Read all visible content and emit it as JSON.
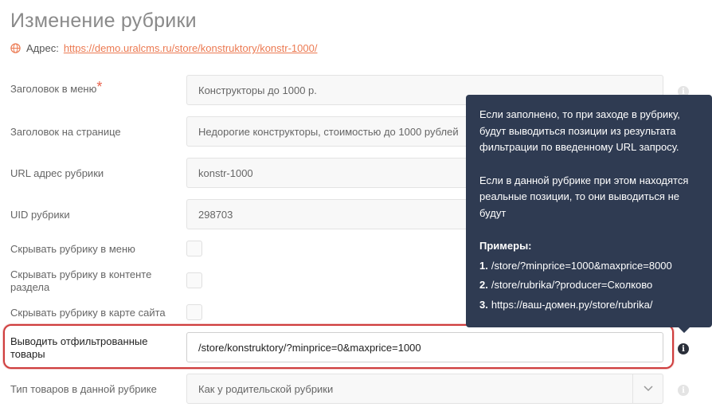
{
  "page_title": "Изменение рубрики",
  "address": {
    "label": "Адрес:",
    "url": "https://demo.uralcms.ru/store/konstruktory/konstr-1000/"
  },
  "fields": {
    "menu_title": {
      "label": "Заголовок в меню",
      "required_mark": "*",
      "value": "Конструкторы до 1000 р."
    },
    "page_title": {
      "label": "Заголовок на странице",
      "value": "Недорогие конструкторы, стоимостью до 1000 рублей"
    },
    "url": {
      "label": "URL адрес рубрики",
      "value": "konstr-1000"
    },
    "uid": {
      "label": "UID рубрики",
      "value": "298703"
    },
    "hide_menu": {
      "label": "Скрывать рубрику в меню",
      "checked": false
    },
    "hide_content": {
      "label": "Скрывать рубрику в контенте раздела",
      "checked": false
    },
    "hide_sitemap": {
      "label": "Скрывать рубрику в карте сайта",
      "checked": false
    },
    "filtered": {
      "label": "Выводить отфильтрованные товары",
      "value": "/store/konstruktory/?minprice=0&maxprice=1000"
    },
    "goods_type": {
      "label": "Тип товаров в данной рубрике",
      "value": "Как у родительской рубрики"
    }
  },
  "tooltip": {
    "para1": "Если заполнено, то при заходе в рубрику, будут выводиться позиции из результата фильтрации по введенному URL запросу.",
    "para2": "Если в данной рубрике при этом находятся реальные позиции, то они выводиться не будут",
    "examples_title": "Примеры:",
    "examples": [
      {
        "num": "1.",
        "text": "/store/?minprice=1000&maxprice=8000"
      },
      {
        "num": "2.",
        "text": "/store/rubrika/?producer=Сколково"
      },
      {
        "num": "3.",
        "text": "https://ваш-домен.ру/store/rubrika/"
      }
    ]
  },
  "icons": {
    "address": "globe-icon",
    "info": "info-icon",
    "select": "chevron-down-icon"
  },
  "colors": {
    "accent_link": "#ec7a52",
    "required": "#e8604a",
    "highlight": "#cf3d3d",
    "tooltip_bg": "#2f3b52"
  }
}
